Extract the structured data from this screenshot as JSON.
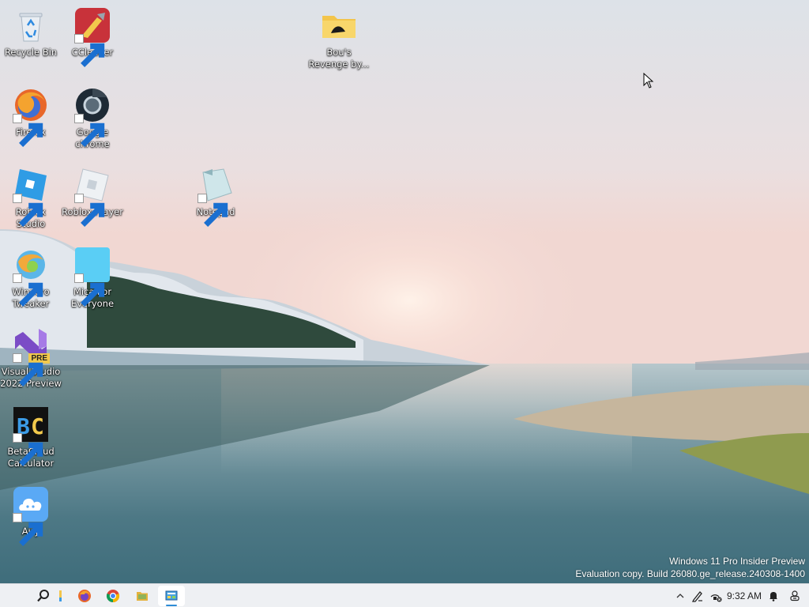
{
  "desktop": {
    "icons": [
      {
        "label": "Recycle Bin",
        "icon": "recycle-bin-icon",
        "shortcut": false
      },
      {
        "label": "CCleaner",
        "icon": "ccleaner-icon",
        "shortcut": true
      },
      {
        "label": "Bou's\nRevenge by...",
        "icon": "folder-icon",
        "shortcut": false
      },
      {
        "label": "Firefox",
        "icon": "firefox-icon",
        "shortcut": true
      },
      {
        "label": "Google\nchrome",
        "icon": "chrome-icon",
        "shortcut": true
      },
      {
        "label": "Roblox Studio",
        "icon": "roblox-studio-icon",
        "shortcut": true
      },
      {
        "label": "Roblox Player",
        "icon": "roblox-player-icon",
        "shortcut": true
      },
      {
        "label": "Notepad",
        "icon": "notepad-icon",
        "shortcut": true
      },
      {
        "label": "Winaero\nTweaker",
        "icon": "winaero-tweaker-icon",
        "shortcut": true
      },
      {
        "label": "Mica For\nEveryone",
        "icon": "mica-for-everyone-icon",
        "shortcut": true
      },
      {
        "label": "Visual Studio\n2022 Preview",
        "icon": "visual-studio-icon",
        "badge": "PRE",
        "shortcut": true
      },
      {
        "label": "BetaCloud\nCalculator",
        "icon": "betacloud-calculator-icon",
        "shortcut": true
      },
      {
        "label": "Airy",
        "icon": "airy-icon",
        "shortcut": true
      }
    ]
  },
  "watermark": {
    "line1": "Windows 11 Pro Insider Preview",
    "line2": "Evaluation copy. Build 26080.ge_release.240308-1400"
  },
  "taskbar": {
    "pinned": [
      {
        "name": "search-icon"
      },
      {
        "name": "file-explorer-icon"
      },
      {
        "name": "firefox-icon"
      },
      {
        "name": "chrome-icon"
      },
      {
        "name": "folder-app-icon"
      },
      {
        "name": "control-panel-icon",
        "active": true
      }
    ],
    "tray": [
      {
        "name": "show-hidden-icons-chevron"
      },
      {
        "name": "pen-icon"
      },
      {
        "name": "network-disconnected-icon"
      }
    ],
    "clock": "9:32 AM",
    "notification": "bell-icon",
    "copilot": "copilot-icon"
  },
  "colors": {
    "taskbar_bg": "#eef0f3",
    "accent": "#2d8cd6"
  }
}
